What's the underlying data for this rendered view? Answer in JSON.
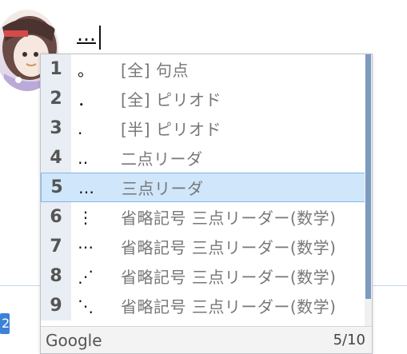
{
  "composer": {
    "text": "…"
  },
  "ime": {
    "candidates": [
      {
        "index": "1",
        "text": "。",
        "description": "[全] 句点"
      },
      {
        "index": "2",
        "text": "．",
        "description": "[全] ピリオド"
      },
      {
        "index": "3",
        "text": ".",
        "description": "[半] ピリオド"
      },
      {
        "index": "4",
        "text": "‥",
        "description": "二点リーダ"
      },
      {
        "index": "5",
        "text": "…",
        "description": "三点リーダ"
      },
      {
        "index": "6",
        "text": "⋮",
        "description": "省略記号 三点リーダー(数学)"
      },
      {
        "index": "7",
        "text": "⋯",
        "description": "省略記号 三点リーダー(数学)"
      },
      {
        "index": "8",
        "text": "⋰",
        "description": "省略記号 三点リーダー(数学)"
      },
      {
        "index": "9",
        "text": "⋱",
        "description": "省略記号 三点リーダー(数学)"
      }
    ],
    "selected_index": 5,
    "footer": {
      "brand": "Google",
      "page": "5/10"
    }
  },
  "background": {
    "badge_text": "2",
    "accent": "#3b82d8"
  }
}
